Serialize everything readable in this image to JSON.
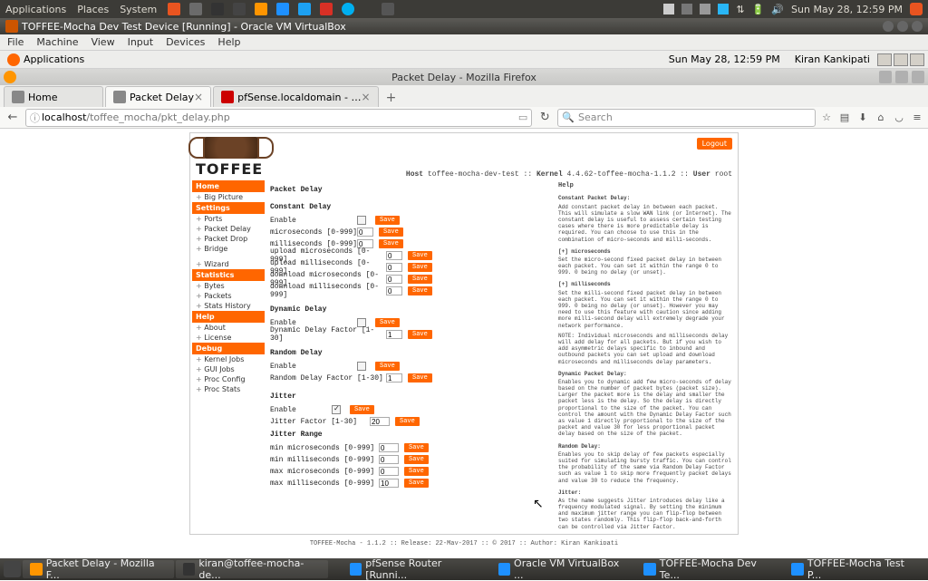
{
  "gnome": {
    "menus": [
      "Applications",
      "Places",
      "System"
    ],
    "clock": "Sun May 28, 12:59 PM"
  },
  "vbox": {
    "title": "TOFFEE-Mocha Dev Test Device [Running] - Oracle VM VirtualBox",
    "menu": [
      "File",
      "Machine",
      "View",
      "Input",
      "Devices",
      "Help"
    ]
  },
  "guest": {
    "apps_label": "Applications",
    "clock": "Sun May 28, 12:59 PM",
    "user": "Kiran Kankipati"
  },
  "firefox": {
    "title": "Packet Delay - Mozilla Firefox",
    "tabs": [
      {
        "label": "Home"
      },
      {
        "label": "Packet Delay"
      },
      {
        "label": "pfSense.localdomain - …"
      }
    ],
    "newtab": "+",
    "url_host": "localhost",
    "url_path": "/toffee_mocha/pkt_delay.php",
    "search_placeholder": "Search"
  },
  "page": {
    "logo_text": "TOFFEE",
    "hostline_pre": "Host",
    "hostline_host": " toffee-mocha-dev-test :: ",
    "hostline_kernel_lbl": "Kernel",
    "hostline_kernel": " 4.4.62-toffee-mocha-1.1.2 :: ",
    "hostline_user_lbl": "User",
    "hostline_user": " root",
    "logout": "Logout",
    "sidebar": {
      "headers": [
        "Home",
        "Settings",
        "Statistics",
        "Help",
        "Debug"
      ],
      "home": [
        "Big Picture"
      ],
      "settings": [
        "Ports",
        "Packet Delay",
        "Packet Drop",
        "Bridge",
        "",
        "Wizard"
      ],
      "statistics": [
        "Bytes",
        "Packets",
        "Stats History"
      ],
      "help": [
        "About",
        "License"
      ],
      "debug": [
        "Kernel Jobs",
        "GUI Jobs",
        "Proc Config",
        "Proc Stats"
      ]
    },
    "main": {
      "title": "Packet Delay",
      "save": "Save",
      "const": {
        "title": "Constant Delay",
        "enable": "Enable",
        "us": "microseconds [0-999]",
        "ms": "milliseconds [0-999]",
        "uus": "upload microseconds [0-999]",
        "ums": "upload milliseconds [0-999]",
        "dus": "download microseconds [0-999]",
        "dms": "download milliseconds [0-999]",
        "val0": "0"
      },
      "dyn": {
        "title": "Dynamic Delay",
        "enable": "Enable",
        "factor": "Dynamic Delay Factor [1-30]",
        "val": "1"
      },
      "rand": {
        "title": "Random Delay",
        "enable": "Enable",
        "factor": "Random Delay Factor [1-30]",
        "val": "1"
      },
      "jitter": {
        "title": "Jitter",
        "enable": "Enable",
        "factor": "Jitter Factor [1-30]",
        "factor_val": "20",
        "range": "Jitter Range",
        "minus": "min microseconds [0-999]",
        "minms": "min milliseconds [0-999]",
        "maxus": "max microseconds [0-999]",
        "maxms": "max milliseconds [0-999]",
        "v0": "0",
        "v10": "10"
      }
    },
    "help": {
      "title": "Help",
      "h1": "Constant Packet Delay:",
      "p1": "Add constant packet delay in between each packet. This will simulate a slow WAN link (or Internet). The constant delay is useful to assess certain testing cases where there is more predictable delay is required. You can choose to use this in the combination of micro-seconds and milli-seconds.",
      "h2": "[+] microseconds",
      "p2": "Set the micro-second fixed packet delay in between each packet. You can set it within the range 0 to 999. 0 being no delay (or unset).",
      "h3": "[+] milliseconds",
      "p3": "Set the milli-second fixed packet delay in between each packet. You can set it within the range 0 to 999. 0 being no delay (or unset). However you may need to use this feature with caution since adding more milli-second delay will extremely degrade your network performance.",
      "p3b": "NOTE: Individual microseconds and milliseconds delay will add delay for all packets. But if you wish to add asymmetric delays specific to inbound and outbound packets you can set upload and download microseconds and milliseconds delay parameters.",
      "h4": "Dynamic Packet Delay:",
      "p4": "Enables you to dynamic add few micro-seconds of delay based on the number of packet bytes (packet size). Larger the packet more is the delay and smaller the packet less is the delay. So the delay is directly proportional to the size of the packet. You can control the amount with the Dynamic Delay Factor such as value 1 directly proportional to the size of the packet and value 30 for less proportional packet delay based on the size of the packet.",
      "h5": "Random Delay:",
      "p5": "Enables you to skip delay of few packets especially suited for simulating bursty traffic. You can control the probability of the same via Random Delay Factor such as value 1 to skip more frequently packet delays and value 30 to reduce the frequency.",
      "h6": "Jitter:",
      "p6": "As the name suggests Jitter introduces delay like a frequency modulated signal. By setting the minimum and maximum jitter range you can flip-flop between two states randomly. This flip-flop back-and-forth can be controlled via Jitter Factor."
    },
    "footer": "TOFFEE-Mocha - 1.1.2 :: Release: 22-May-2017 :: © 2017 :: Author: Kiran Kankipati"
  },
  "taskbar": {
    "items": [
      "Packet Delay - Mozilla F...",
      "kiran@toffee-mocha-de...",
      "pfSense Router [Runni...",
      "Oracle VM VirtualBox ...",
      "TOFFEE-Mocha Dev Te...",
      "TOFFEE-Mocha Test P..."
    ]
  }
}
